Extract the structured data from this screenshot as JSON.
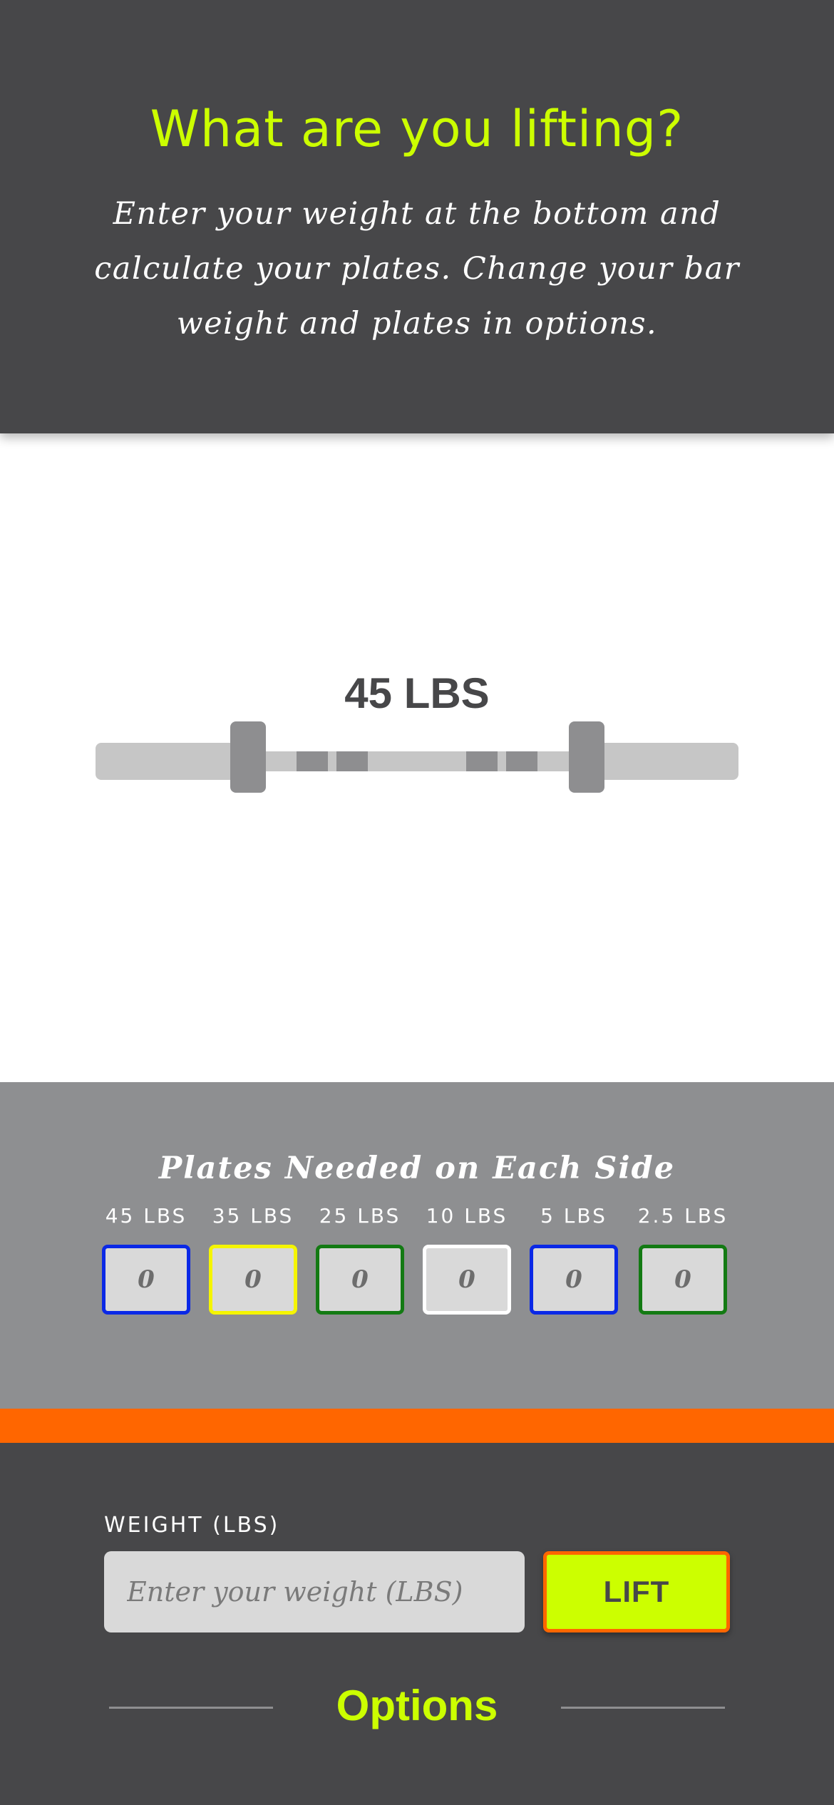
{
  "header": {
    "title": "What are you lifting?",
    "subtitle": "Enter your weight at the bottom and calculate your plates. Change your bar weight and plates in options."
  },
  "barbell": {
    "total_label": "45 LBS"
  },
  "plates": {
    "title": "Plates Needed on Each Side",
    "items": [
      {
        "label": "45 LBS",
        "count": "0",
        "color": "#0a28e6"
      },
      {
        "label": "35 LBS",
        "count": "0",
        "color": "#f5f500"
      },
      {
        "label": "25 LBS",
        "count": "0",
        "color": "#137a13"
      },
      {
        "label": "10 LBS",
        "count": "0",
        "color": "#ffffff"
      },
      {
        "label": "5 LBS",
        "count": "0",
        "color": "#0a28e6"
      },
      {
        "label": "2.5 LBS",
        "count": "0",
        "color": "#137a13"
      }
    ]
  },
  "form": {
    "weight_label": "WEIGHT (LBS)",
    "weight_placeholder": "Enter your weight (LBS)",
    "weight_value": "",
    "lift_button": "LIFT",
    "options_link": "Options"
  },
  "colors": {
    "accent": "#ccff00",
    "orange": "#ff6600",
    "dark": "#474749",
    "gray": "#8e8f91"
  }
}
